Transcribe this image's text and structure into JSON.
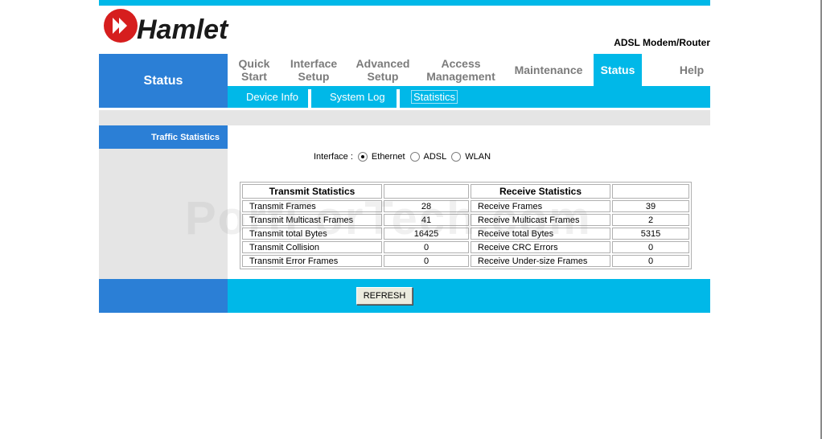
{
  "brand": {
    "logo_text": "Hamlet",
    "product": "ADSL Modem/Router",
    "color_primary": "#00b8e8",
    "color_secondary": "#2b7fd6",
    "color_logo": "#d61e1e"
  },
  "section_title": "Status",
  "nav": [
    {
      "line1": "Quick",
      "line2": "Start"
    },
    {
      "line1": "Interface",
      "line2": "Setup"
    },
    {
      "line1": "Advanced",
      "line2": "Setup"
    },
    {
      "line1": "Access",
      "line2": "Management"
    },
    {
      "line1": "Maintenance",
      "line2": ""
    },
    {
      "line1": "Status",
      "line2": "",
      "active": true
    },
    {
      "line1": "Help",
      "line2": ""
    }
  ],
  "subnav": [
    {
      "label": "Device Info"
    },
    {
      "label": "System Log"
    },
    {
      "label": "Statistics",
      "active": true
    }
  ],
  "sidebar": {
    "traffic_statistics": "Traffic Statistics"
  },
  "interface": {
    "label": "Interface :",
    "options": [
      "Ethernet",
      "ADSL",
      "WLAN"
    ],
    "selected": "Ethernet"
  },
  "table": {
    "transmit_header": "Transmit Statistics",
    "receive_header": "Receive Statistics",
    "rows": [
      {
        "tx_label": "Transmit Frames",
        "tx_value": "28",
        "rx_label": "Receive Frames",
        "rx_value": "39"
      },
      {
        "tx_label": "Transmit Multicast Frames",
        "tx_value": "41",
        "rx_label": "Receive Multicast Frames",
        "rx_value": "2"
      },
      {
        "tx_label": "Transmit total Bytes",
        "tx_value": "16425",
        "rx_label": "Receive total Bytes",
        "rx_value": "5315"
      },
      {
        "tx_label": "Transmit Collision",
        "tx_value": "0",
        "rx_label": "Receive CRC Errors",
        "rx_value": "0"
      },
      {
        "tx_label": "Transmit Error Frames",
        "tx_value": "0",
        "rx_label": "Receive Under-size Frames",
        "rx_value": "0"
      }
    ]
  },
  "refresh_label": "REFRESH",
  "watermark": "PortForTech.com"
}
